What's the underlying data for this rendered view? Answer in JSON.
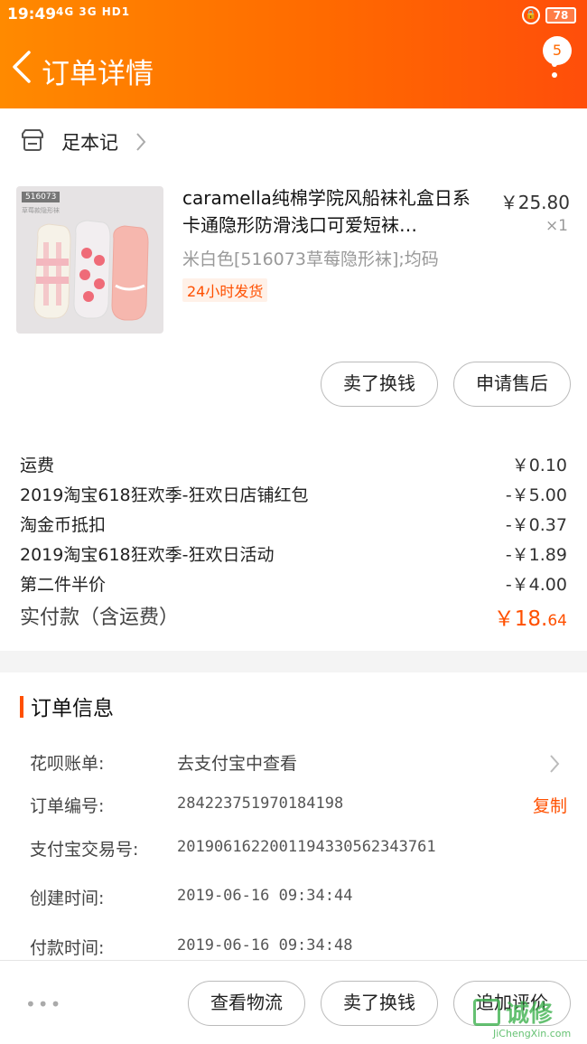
{
  "status_bar": {
    "time": "19:49",
    "signal": "4G 3G HD1",
    "battery": "78"
  },
  "header": {
    "title": "订单详情",
    "badge_count": "5"
  },
  "shop": {
    "name": "足本记"
  },
  "product": {
    "image_tag": "516073",
    "image_subtext": "草莓款隐形袜",
    "title": "caramella纯棉学院风船袜礼盒日系卡通隐形防滑浅口可爱短袜…",
    "price": "￥25.80",
    "quantity": "×1",
    "sku": "米白色[516073草莓隐形袜];均码",
    "shipping_tag": "24小时发货"
  },
  "item_actions": {
    "sell_label": "卖了换钱",
    "after_sales_label": "申请售后"
  },
  "fees": [
    {
      "label": "运费",
      "value": "￥0.10"
    },
    {
      "label": "2019淘宝618狂欢季-狂欢日店铺红包",
      "value": "-￥5.00"
    },
    {
      "label": "淘金币抵扣",
      "value": "-￥0.37"
    },
    {
      "label": "2019淘宝618狂欢季-狂欢日活动",
      "value": "-￥1.89"
    },
    {
      "label": "第二件半价",
      "value": "-￥4.00"
    }
  ],
  "total": {
    "label": "实付款（含运费）",
    "value_main": "￥18.",
    "value_cents": "64"
  },
  "order_info": {
    "title": "订单信息",
    "huabei_label": "花呗账单:",
    "huabei_value": "去支付宝中查看",
    "order_no_label": "订单编号:",
    "order_no_value": "284223751970184198",
    "copy_label": "复制",
    "alipay_label": "支付宝交易号:",
    "alipay_value": "2019061622001194330562343761",
    "created_label": "创建时间:",
    "created_value": "2019-06-16 09:34:44",
    "paid_label": "付款时间:",
    "paid_value": "2019-06-16 09:34:48"
  },
  "bottom_bar": {
    "more_dots": "•••",
    "logistics_label": "查看物流",
    "sell_label": "卖了换钱",
    "review_label": "追加评价"
  },
  "watermark": {
    "cn": "诚修",
    "en": "JiChengXin.com"
  },
  "colors": {
    "accent": "#ff5000",
    "header_start": "#ff8a00",
    "header_end": "#ff4e0a"
  }
}
